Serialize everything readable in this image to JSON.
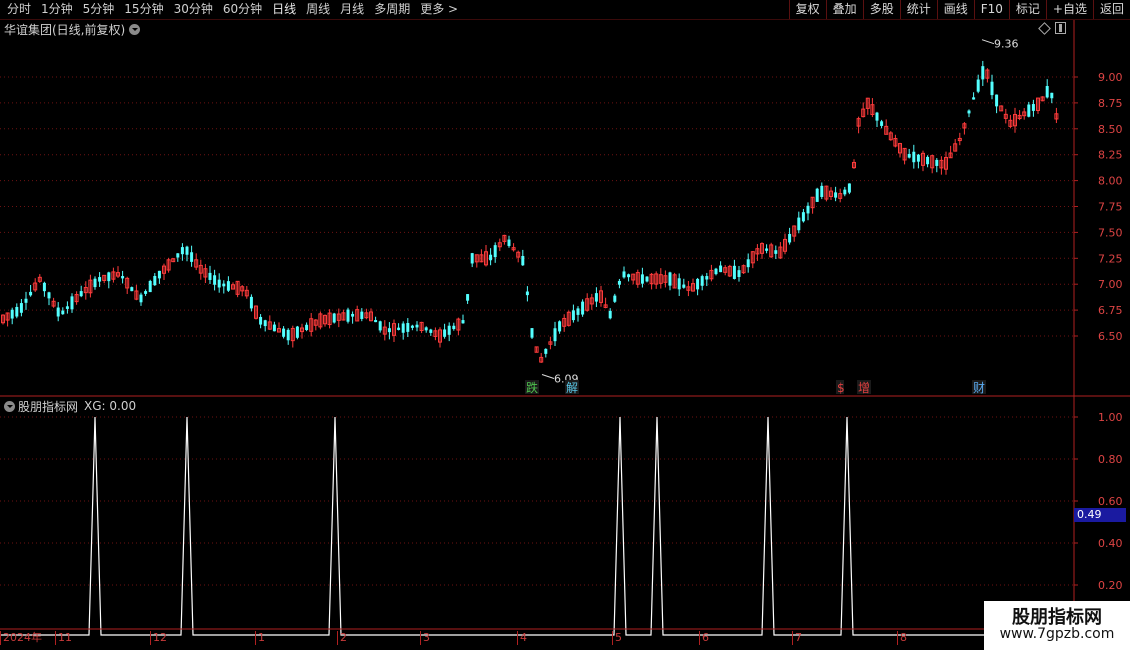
{
  "toolbar": {
    "periods": [
      "分时",
      "1分钟",
      "5分钟",
      "15分钟",
      "30分钟",
      "60分钟",
      "日线",
      "周线",
      "月线",
      "多周期",
      "更多"
    ],
    "more_arrow": ">",
    "buttons": [
      "复权",
      "叠加",
      "多股",
      "统计",
      "画线",
      "F10",
      "标记",
      "+自选",
      "返回"
    ]
  },
  "main": {
    "title": "华谊集团(日线,前复权)",
    "high_label": "9.36",
    "low_label": "6.09",
    "y_ticks": [
      "9.00",
      "8.75",
      "8.50",
      "8.25",
      "8.00",
      "7.75",
      "7.50",
      "7.25",
      "7.00",
      "6.75",
      "6.50"
    ],
    "markers": [
      {
        "text": "跌",
        "color": "#4ec24e"
      },
      {
        "text": "解",
        "color": "#59c6e6"
      },
      {
        "text": "$",
        "color": "#e04040"
      },
      {
        "text": "增",
        "color": "#e04040"
      },
      {
        "text": "财",
        "color": "#5aaaf0"
      }
    ]
  },
  "indicator": {
    "title": "股朋指标网",
    "xg": "XG: 0.00",
    "y_ticks": [
      "1.00",
      "0.80",
      "0.60",
      "0.40",
      "0.20"
    ],
    "current_value": "0.49",
    "spikes": 7
  },
  "dates": [
    "2024年",
    "11",
    "12",
    "1",
    "2",
    "3",
    "4",
    "5",
    "6",
    "7",
    "8"
  ],
  "watermark": {
    "line1": "股朋指标网",
    "line2": "www.7gpzb.com"
  },
  "colors": {
    "up": "#ff3b3b",
    "down": "#54ffff",
    "grid": "#6e1212",
    "axis": "#b02020"
  }
}
